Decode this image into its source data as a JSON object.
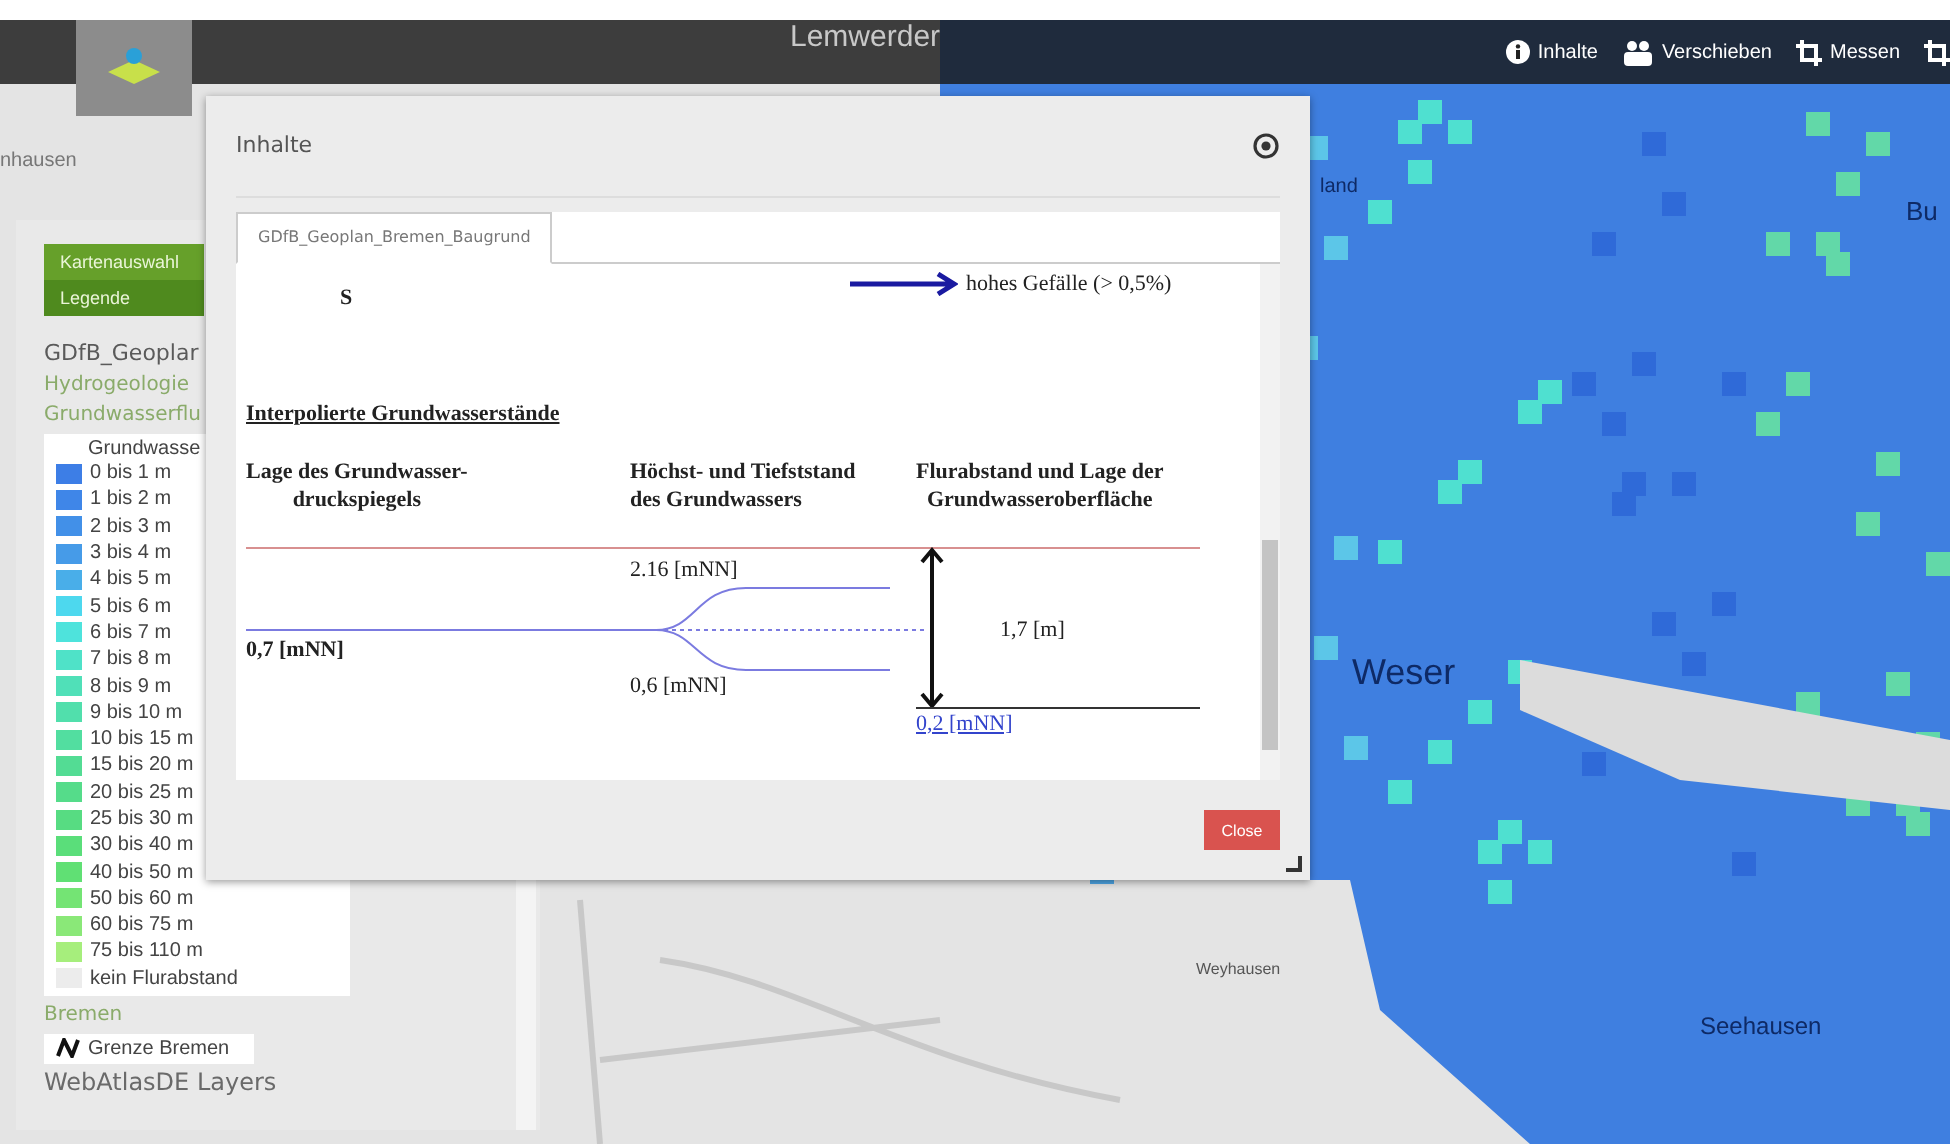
{
  "toolbar": {
    "items": [
      {
        "kind": "info",
        "label": "Inhalte"
      },
      {
        "kind": "move",
        "label": "Verschieben"
      },
      {
        "kind": "crop",
        "label": "Messen"
      },
      {
        "kind": "crop"
      }
    ]
  },
  "map_labels": [
    "Lemwerder",
    "nhausen",
    "land",
    "Bu",
    "Weser",
    "Weyhausen",
    "Seehausen"
  ],
  "sidebar": {
    "buttons": [
      {
        "label": "Kartenauswahl",
        "selected": false
      },
      {
        "label": "Legende",
        "selected": true
      }
    ],
    "layer_title": "GDfB_Geoplar",
    "group": "Hydrogeologie",
    "layer": "Grundwasserflu",
    "legend": {
      "title": "Grundwasse",
      "items": [
        {
          "label": "0 bis 1 m",
          "color": "#3d7ee6"
        },
        {
          "label": "1 bis 2 m",
          "color": "#3f86e8"
        },
        {
          "label": "2 bis 3 m",
          "color": "#4290e8"
        },
        {
          "label": "3 bis 4 m",
          "color": "#469be8"
        },
        {
          "label": "4 bis 5 m",
          "color": "#49aee9"
        },
        {
          "label": "5 bis 6 m",
          "color": "#4dd8ee"
        },
        {
          "label": "6 bis 7 m",
          "color": "#4ee3dc"
        },
        {
          "label": "7 bis 8 m",
          "color": "#4fe2c8"
        },
        {
          "label": "8 bis 9 m",
          "color": "#50e0b8"
        },
        {
          "label": "9 bis 10 m",
          "color": "#51dfac"
        },
        {
          "label": "10 bis 15 m",
          "color": "#52dea0"
        },
        {
          "label": "15 bis 20 m",
          "color": "#53dc94"
        },
        {
          "label": "20 bis 25 m",
          "color": "#55dc8a"
        },
        {
          "label": "25 bis 30 m",
          "color": "#57dc82"
        },
        {
          "label": "30 bis 40 m",
          "color": "#5ade7a"
        },
        {
          "label": "40 bis 50 m",
          "color": "#60e074"
        },
        {
          "label": "50 bis 60 m",
          "color": "#74e474"
        },
        {
          "label": "60 bis 75 m",
          "color": "#8ae878"
        },
        {
          "label": "75 bis 110 m",
          "color": "#a6ee7c"
        },
        {
          "label": "kein Flurabstand",
          "color": "#ececec"
        }
      ]
    },
    "group_2": "Bremen",
    "boundary_item": "Grenze Bremen",
    "layers_title": "WebAtlasDE Layers"
  },
  "dialog": {
    "title": "Inhalte",
    "tabs": [
      {
        "label": "GDfB_Geoplan_Bremen_Baugrund",
        "selected": true
      }
    ],
    "document": {
      "symbol": "S",
      "arrow_caption": "hohes Gefälle (> 0,5%)",
      "section_title": "Interpolierte Grundwasserstände",
      "headings": [
        "Lage des Grundwasser-\ndruckspiegels",
        "Höchst- und Tiefststand\ndes Grundwassers",
        "Flurabstand und Lage der\nGrundwasseroberfläche"
      ],
      "pressure_level": "0,7 [mNN]",
      "highest": "2.16 [mNN]",
      "lowest": "0,6 [mNN]",
      "depth": "1,7 [m]",
      "surface_link": "0,2 [mNN]"
    },
    "close_button": "Close"
  }
}
